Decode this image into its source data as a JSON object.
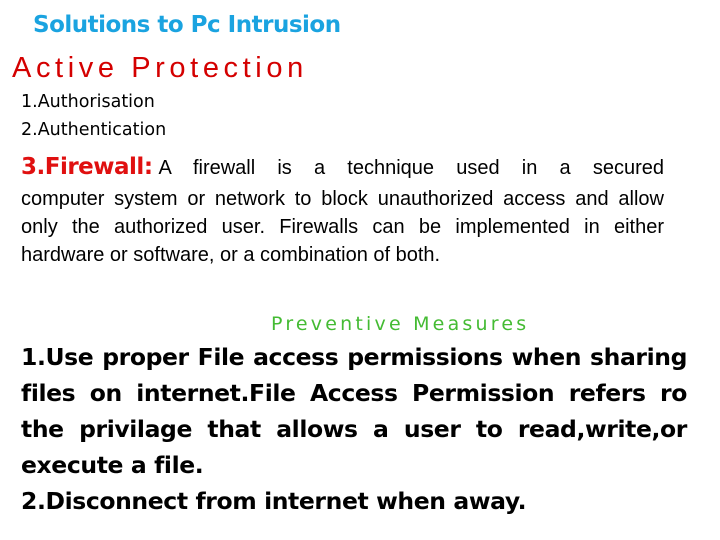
{
  "slide": {
    "title": "Solutions to Pc Intrusion",
    "section_heading": "Active Protection",
    "list": [
      "1.Authorisation",
      "2.Authentication"
    ],
    "firewall": {
      "label": "3.Firewall:",
      "first_line": "A firewall is a technique used in a secured",
      "rest": "computer system or network to block unauthorized access and allow only the authorized user. Firewalls can be implemented in either hardware or software, or a combination of both."
    },
    "preventive_heading": "Preventive Measures",
    "measures": [
      "1.Use proper File access permissions when sharing files on internet.File Access Permission refers ro the privilage that allows a user to read,write,or execute a file.",
      "2.Disconnect from internet when away."
    ],
    "colors": {
      "title": "#1aa3e0",
      "section_heading": "#d40000",
      "firewall_label": "#e01010",
      "preventive_heading": "#44bb33"
    }
  }
}
